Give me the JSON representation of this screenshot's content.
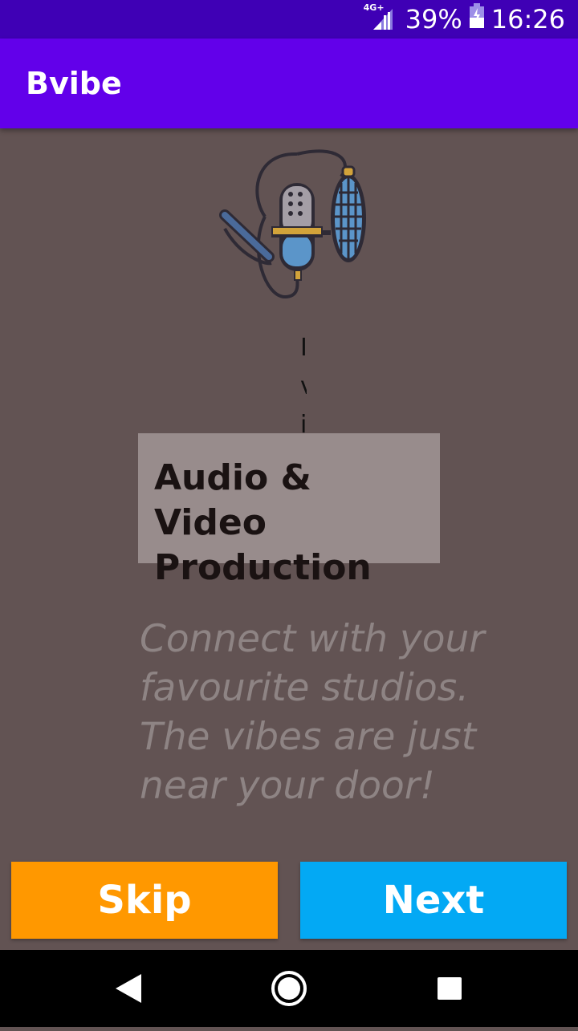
{
  "status_bar": {
    "network": "4G+",
    "battery": "39%",
    "time": "16:26"
  },
  "app_bar": {
    "title": "Bvibe"
  },
  "onboarding": {
    "title": "Audio & Video Production",
    "description": "Connect with your favourite studios. The vibes are just near your door!",
    "garbled_chars": [
      "I",
      "v",
      "i"
    ]
  },
  "buttons": {
    "skip": "Skip",
    "next": "Next"
  },
  "colors": {
    "status_bar": "#3f00b5",
    "app_bar": "#6200ea",
    "background": "#625353",
    "skip": "#ff9800",
    "next": "#03a9f4"
  },
  "icons": [
    "signal-icon",
    "battery-icon",
    "microphone-icon",
    "back-icon",
    "home-icon",
    "recents-icon"
  ]
}
